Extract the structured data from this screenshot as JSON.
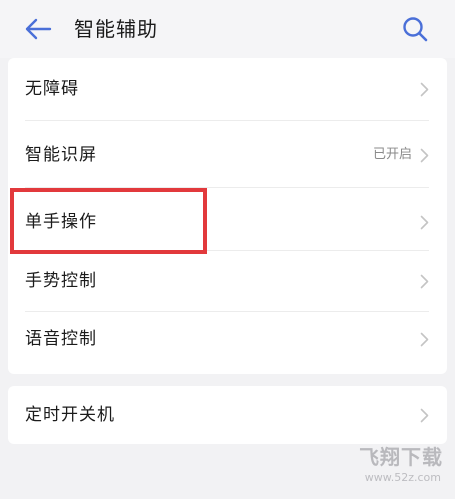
{
  "header": {
    "title": "智能辅助",
    "back_icon": "back-arrow-icon",
    "search_icon": "search-icon"
  },
  "settings": {
    "items": [
      {
        "label": "无障碍",
        "status": ""
      },
      {
        "label": "智能识屏",
        "status": "已开启"
      },
      {
        "label": "单手操作",
        "status": ""
      },
      {
        "label": "手势控制",
        "status": ""
      },
      {
        "label": "语音控制",
        "status": ""
      }
    ],
    "timer_item": {
      "label": "定时开关机",
      "status": ""
    }
  },
  "watermark": {
    "title": "飞翔下载",
    "url": "www.52z.com"
  },
  "colors": {
    "accent": "#4a6fd8",
    "highlight": "#e2393c",
    "background": "#f2f2f4"
  }
}
